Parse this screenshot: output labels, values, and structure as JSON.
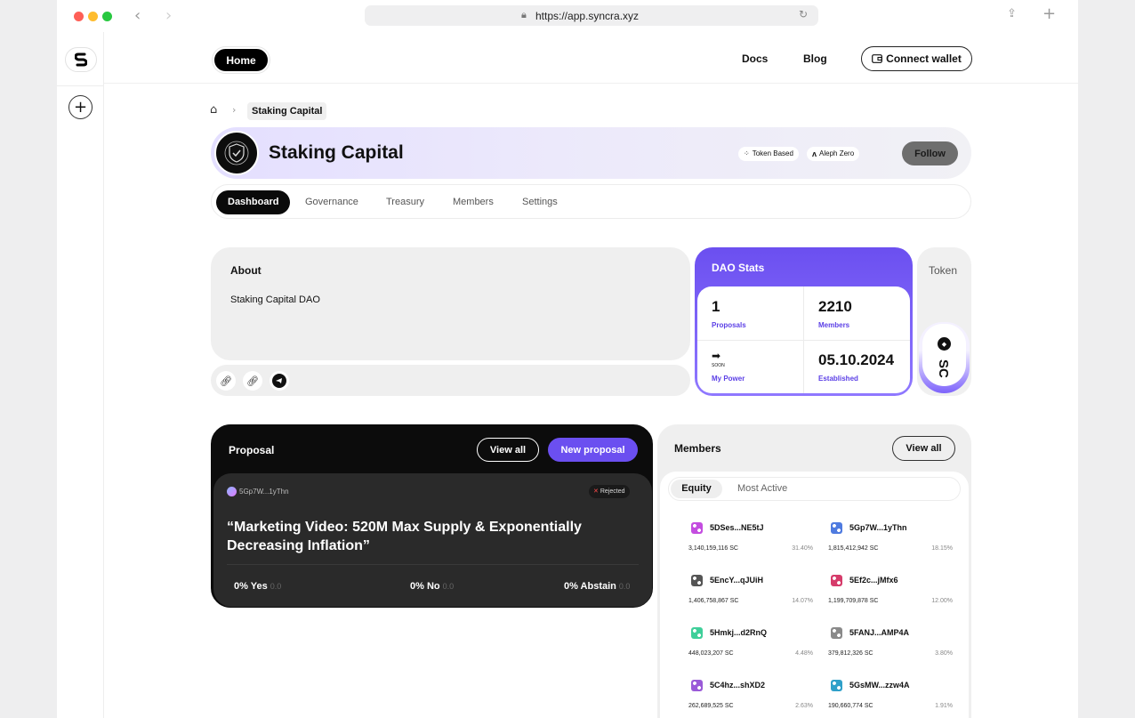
{
  "browser": {
    "url": "https://app.syncra.xyz",
    "colors": {
      "close": "#fe5f57",
      "minimize": "#febc2e",
      "zoom": "#28c840"
    }
  },
  "sidebar": {
    "logo_letter": "S"
  },
  "topnav": {
    "home_label": "Home",
    "docs_label": "Docs",
    "blog_label": "Blog",
    "connect_label": "Connect wallet"
  },
  "breadcrumb": {
    "current": "Staking Capital"
  },
  "dao": {
    "name": "Staking Capital",
    "tags": [
      "Token Based",
      "Aleph Zero"
    ],
    "follow_label": "Follow"
  },
  "tabs": [
    "Dashboard",
    "Governance",
    "Treasury",
    "Members",
    "Settings"
  ],
  "about": {
    "title": "About",
    "description": "Staking Capital DAO"
  },
  "stats": {
    "title": "DAO Stats",
    "proposals_value": "1",
    "proposals_label": "Proposals",
    "members_value": "2210",
    "members_label": "Members",
    "power_soon": "SOON",
    "power_label": "My Power",
    "established_value": "05.10.2024",
    "established_label": "Established"
  },
  "token": {
    "title": "Token",
    "symbol": "SC"
  },
  "proposal": {
    "title": "Proposal",
    "view_all_label": "View all",
    "new_label": "New proposal",
    "author": "5Gp7W...1yThn",
    "status": "Rejected",
    "text": "“Marketing Video: 520M Max Supply & Exponentially Decreasing Inflation”",
    "yes_label": "0% Yes",
    "yes_value": "0.0",
    "no_label": "0% No",
    "no_value": "0.0",
    "abstain_label": "0% Abstain",
    "abstain_value": "0.0",
    "accent": "#6b4ff0"
  },
  "members": {
    "title": "Members",
    "view_all_label": "View all",
    "tab_equity": "Equity",
    "tab_active": "Most Active",
    "list": [
      {
        "name": "5DSes...NE5tJ",
        "amount": "3,140,159,116 SC",
        "pct": "31.40%",
        "color": "#c44de0"
      },
      {
        "name": "5Gp7W...1yThn",
        "amount": "1,815,412,942 SC",
        "pct": "18.15%",
        "color": "#4f7be0"
      },
      {
        "name": "5EncY...qJUiH",
        "amount": "1,406,758,867 SC",
        "pct": "14.07%",
        "color": "#555555"
      },
      {
        "name": "5Ef2c...jMfx6",
        "amount": "1,199,709,878 SC",
        "pct": "12.00%",
        "color": "#d63c6b"
      },
      {
        "name": "5Hmkj...d2RnQ",
        "amount": "448,023,207 SC",
        "pct": "4.48%",
        "color": "#3fcf9a"
      },
      {
        "name": "5FANJ...AMP4A",
        "amount": "379,812,326 SC",
        "pct": "3.80%",
        "color": "#8a8a8a"
      },
      {
        "name": "5C4hz...shXD2",
        "amount": "262,689,525 SC",
        "pct": "2.63%",
        "color": "#9a5ad8"
      },
      {
        "name": "5GsMW...zzw4A",
        "amount": "190,660,774 SC",
        "pct": "1.91%",
        "color": "#2fa0c9"
      }
    ]
  }
}
